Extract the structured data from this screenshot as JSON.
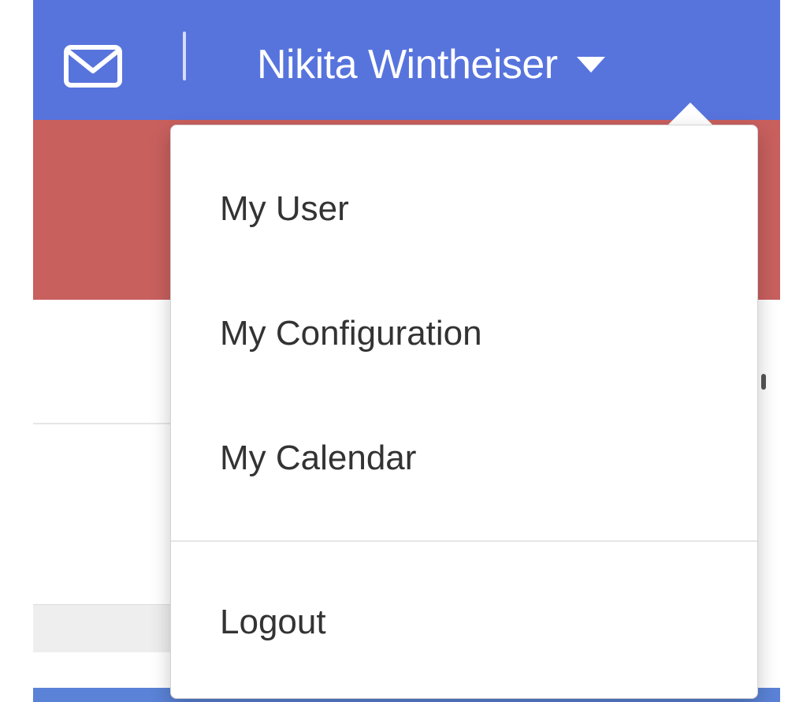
{
  "colors": {
    "navbar": "#5774dd",
    "banner": "#c8605e",
    "bottom_strip": "#5a82d6"
  },
  "navbar": {
    "mail_icon": "envelope-icon",
    "user_name": "Nikita Wintheiser",
    "caret_icon": "caret-down-icon"
  },
  "user_menu": {
    "items": [
      {
        "label": "My User"
      },
      {
        "label": "My Configuration"
      },
      {
        "label": "My Calendar"
      },
      {
        "label": "Logout"
      }
    ]
  }
}
